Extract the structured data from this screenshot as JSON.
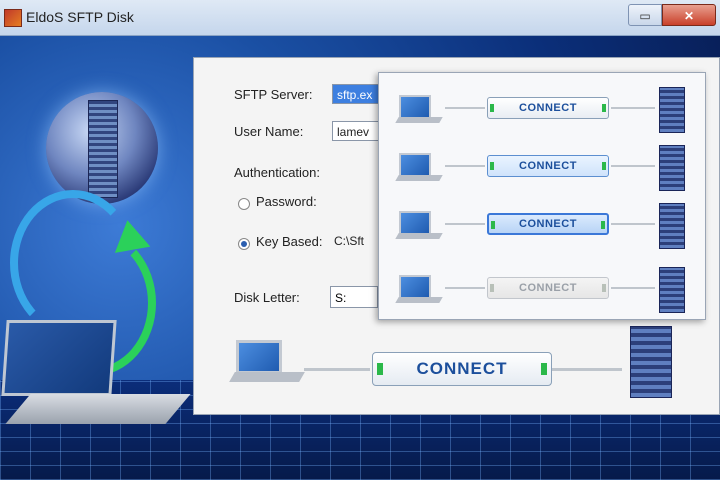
{
  "window": {
    "title": "EldoS SFTP Disk",
    "minimize_glyph": "▭",
    "close_glyph": "✕"
  },
  "form": {
    "server_label": "SFTP Server:",
    "server_value": "sftp.ex",
    "user_label": "User Name:",
    "user_value": "lamev",
    "auth_label": "Authentication:",
    "password_option": "Password:",
    "keybased_option": "Key Based:",
    "keybased_value": "C:\\Sft",
    "selected_auth": "keybased",
    "disk_label": "Disk Letter:",
    "disk_value": "S:"
  },
  "connect_rows": [
    {
      "label": "CONNECT",
      "state": "normal"
    },
    {
      "label": "CONNECT",
      "state": "hover"
    },
    {
      "label": "CONNECT",
      "state": "focus"
    },
    {
      "label": "CONNECT",
      "state": "disabled"
    }
  ],
  "main_connect": {
    "label": "CONNECT"
  },
  "icons": [
    "app-icon",
    "globe-icon",
    "laptop-icon",
    "server-icon",
    "sync-arrows-icon"
  ],
  "colors": {
    "accent": "#1c4f9c",
    "green": "#2bb84a",
    "selection": "#3d7fe0"
  }
}
